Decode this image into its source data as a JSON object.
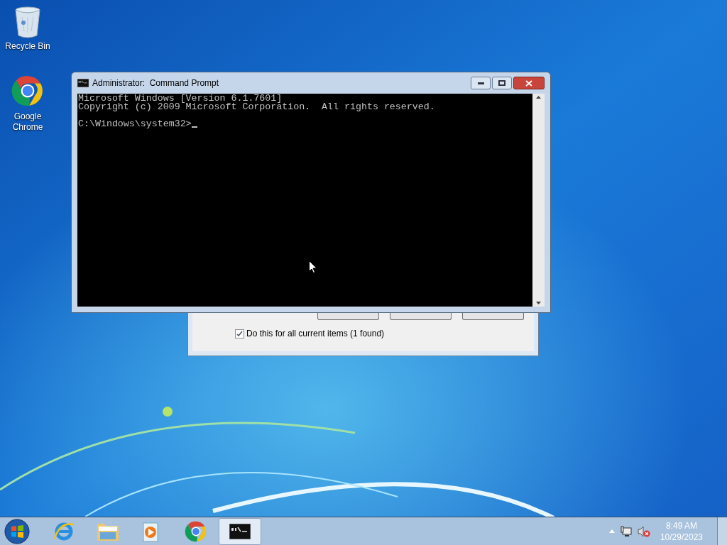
{
  "desktop_icons": [
    {
      "kind": "recycle",
      "label": "Recycle Bin"
    },
    {
      "kind": "chrome",
      "label": "Google Chrome"
    }
  ],
  "background_dialog": {
    "checkbox": {
      "label": "Do this for all current items (1 found)",
      "checked": true
    }
  },
  "console_window": {
    "title": "Administrator:  Command Prompt",
    "output": [
      "Microsoft Windows [Version 6.1.7601]",
      "Copyright (c) 2009 Microsoft Corporation.  All rights reserved."
    ],
    "prompt": "C:\\Windows\\system32>"
  },
  "taskbar": {
    "items": [
      {
        "kind": "ie",
        "selected": false
      },
      {
        "kind": "explorer",
        "selected": false
      },
      {
        "kind": "media",
        "selected": false
      },
      {
        "kind": "chrome",
        "selected": false
      },
      {
        "kind": "cmd",
        "selected": true
      }
    ],
    "time": "8:49 AM",
    "date": "10/29/2023"
  }
}
